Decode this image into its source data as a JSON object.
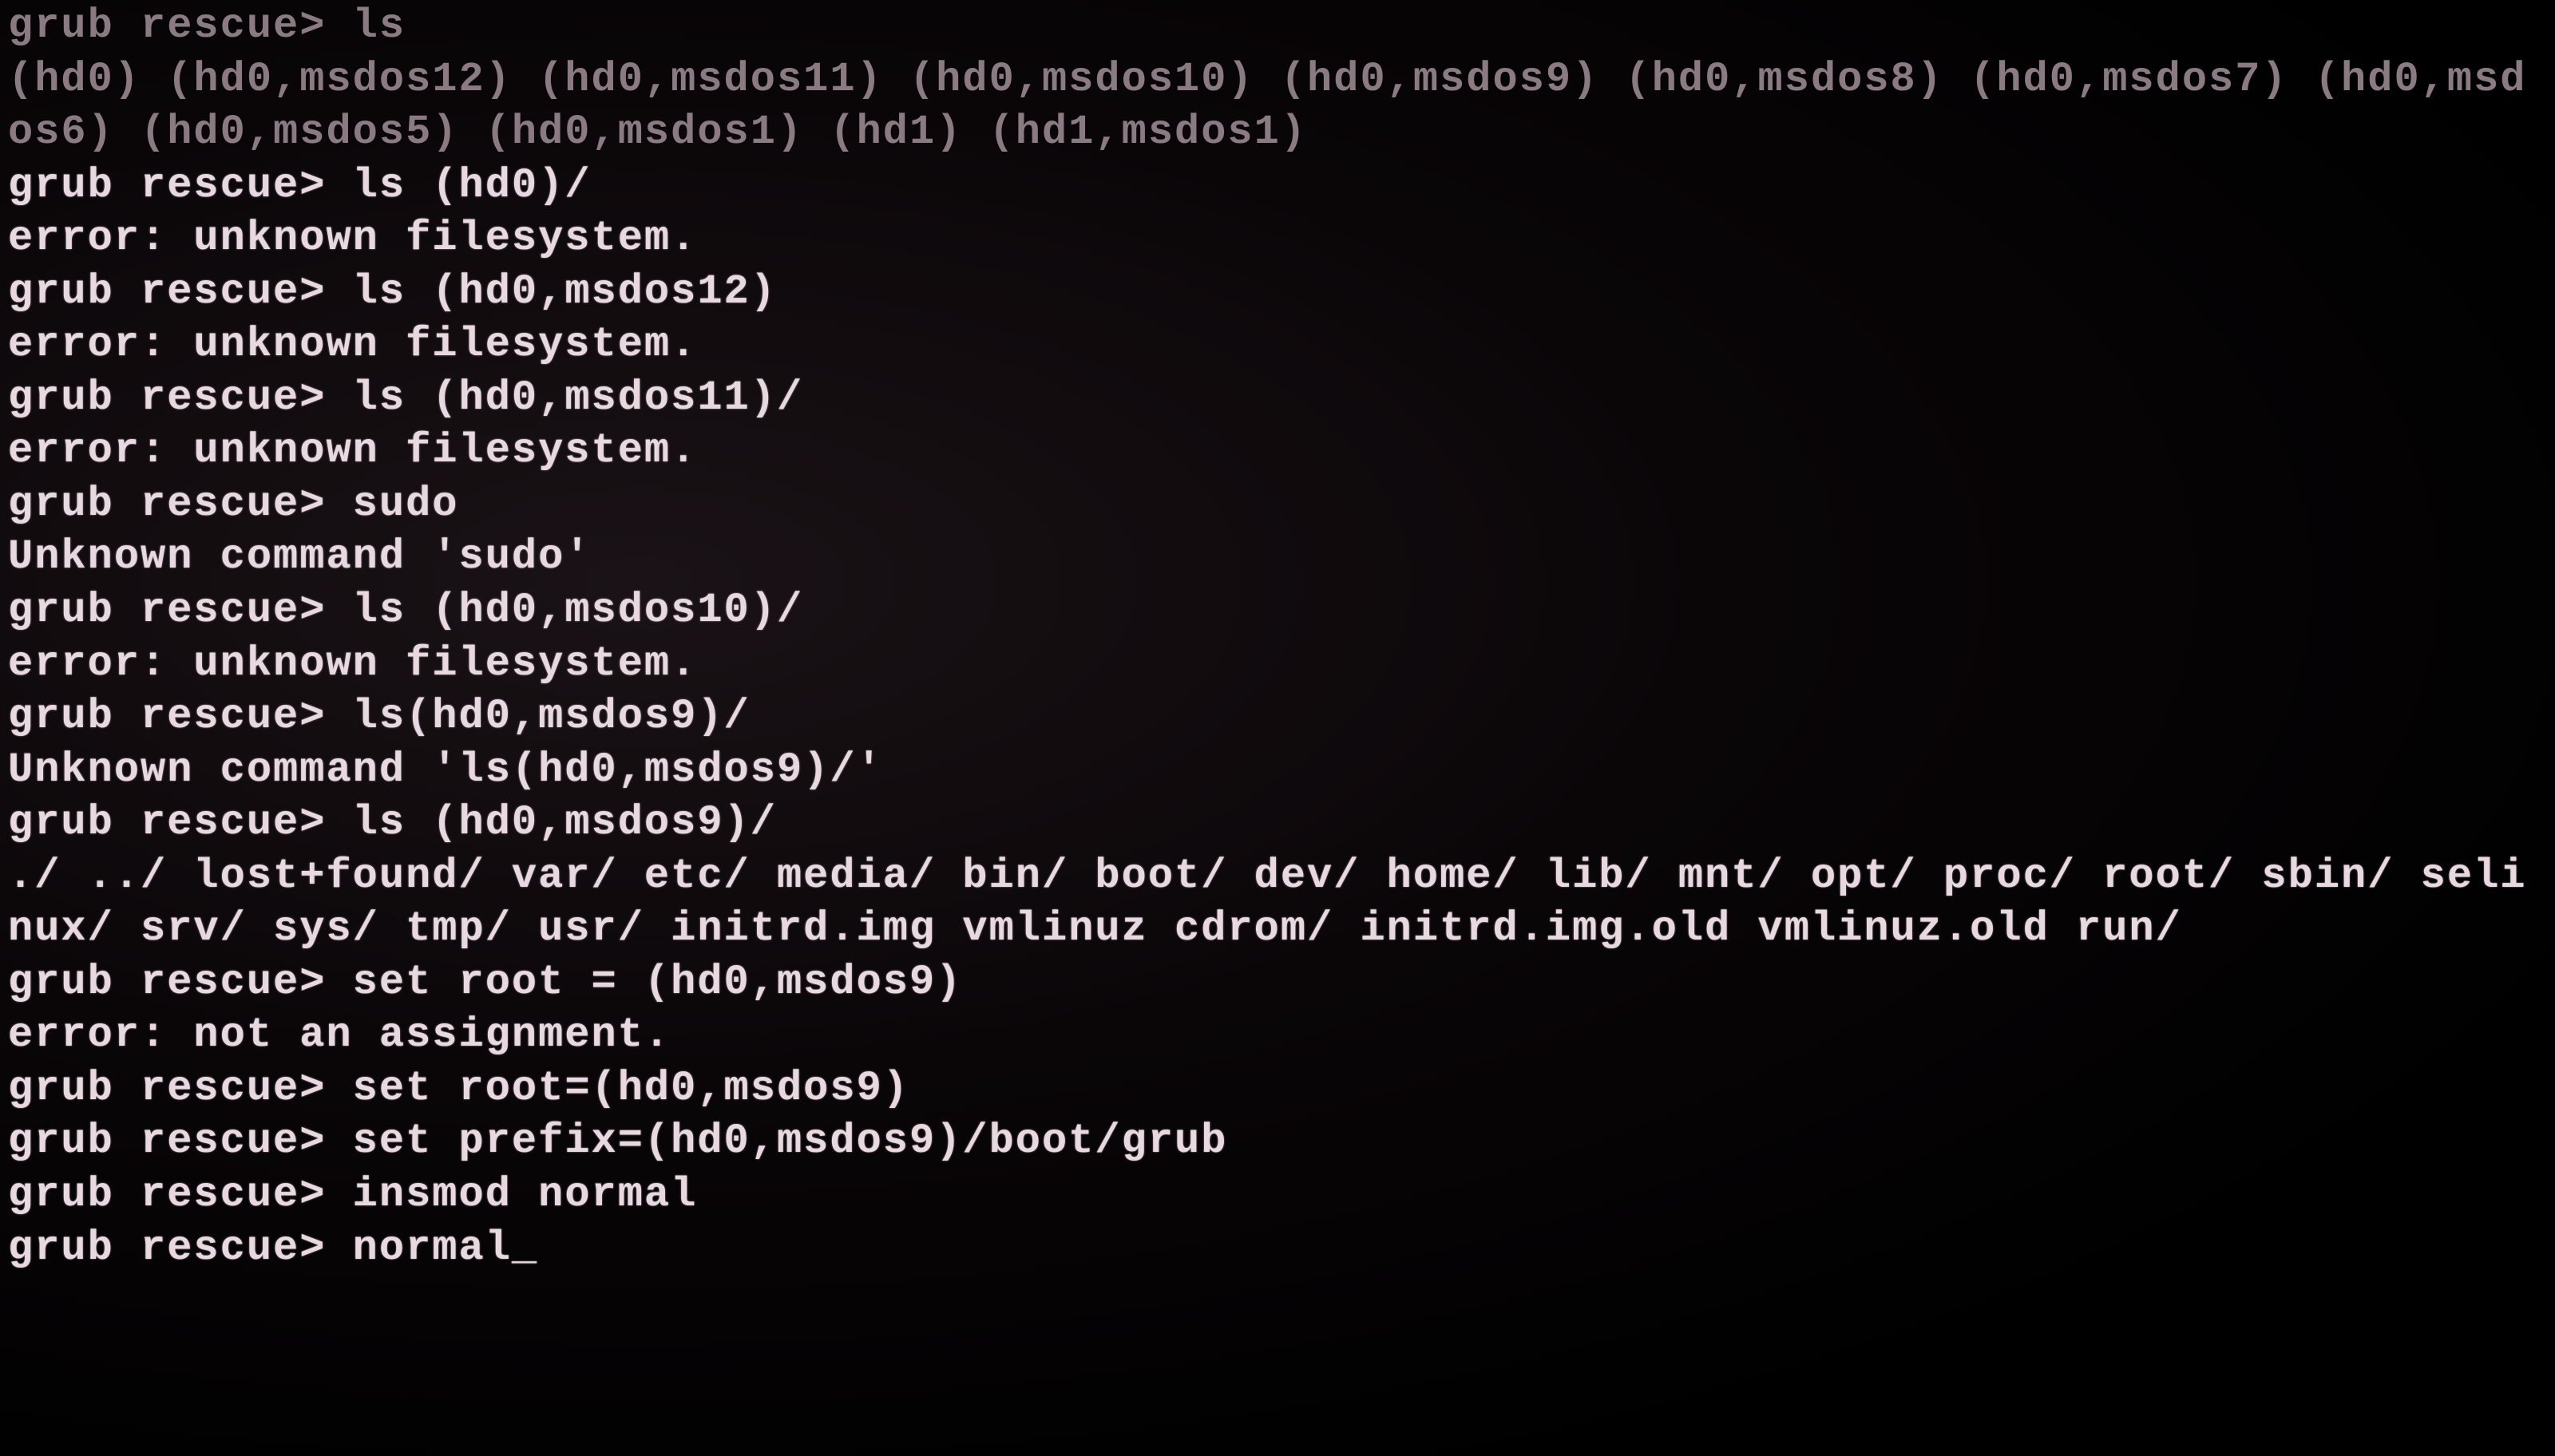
{
  "terminal": {
    "prompt": "grub rescue> ",
    "cursor": "_",
    "lines": [
      {
        "prompt": true,
        "dim": true,
        "text": "ls"
      },
      {
        "prompt": false,
        "dim": true,
        "text": "(hd0) (hd0,msdos12) (hd0,msdos11) (hd0,msdos10) (hd0,msdos9) (hd0,msdos8) (hd0,msdos7) (hd0,msdos6) (hd0,msdos5) (hd0,msdos1) (hd1) (hd1,msdos1)"
      },
      {
        "prompt": true,
        "dim": false,
        "text": "ls (hd0)/"
      },
      {
        "prompt": false,
        "dim": false,
        "text": "error: unknown filesystem."
      },
      {
        "prompt": true,
        "dim": false,
        "text": "ls (hd0,msdos12)"
      },
      {
        "prompt": false,
        "dim": false,
        "text": "error: unknown filesystem."
      },
      {
        "prompt": true,
        "dim": false,
        "text": "ls (hd0,msdos11)/"
      },
      {
        "prompt": false,
        "dim": false,
        "text": "error: unknown filesystem."
      },
      {
        "prompt": true,
        "dim": false,
        "text": "sudo"
      },
      {
        "prompt": false,
        "dim": false,
        "text": "Unknown command 'sudo'"
      },
      {
        "prompt": true,
        "dim": false,
        "text": "ls (hd0,msdos10)/"
      },
      {
        "prompt": false,
        "dim": false,
        "text": "error: unknown filesystem."
      },
      {
        "prompt": true,
        "dim": false,
        "text": "ls(hd0,msdos9)/"
      },
      {
        "prompt": false,
        "dim": false,
        "text": "Unknown command 'ls(hd0,msdos9)/'"
      },
      {
        "prompt": true,
        "dim": false,
        "text": "ls (hd0,msdos9)/"
      },
      {
        "prompt": false,
        "dim": false,
        "text": "./ ../ lost+found/ var/ etc/ media/ bin/ boot/ dev/ home/ lib/ mnt/ opt/ proc/ root/ sbin/ selinux/ srv/ sys/ tmp/ usr/ initrd.img vmlinuz cdrom/ initrd.img.old vmlinuz.old run/"
      },
      {
        "prompt": true,
        "dim": false,
        "text": "set root = (hd0,msdos9)"
      },
      {
        "prompt": false,
        "dim": false,
        "text": "error: not an assignment."
      },
      {
        "prompt": true,
        "dim": false,
        "text": "set root=(hd0,msdos9)"
      },
      {
        "prompt": true,
        "dim": false,
        "text": "set prefix=(hd0,msdos9)/boot/grub"
      },
      {
        "prompt": true,
        "dim": false,
        "text": "insmod normal"
      },
      {
        "prompt": true,
        "dim": false,
        "text": "normal",
        "cursor": true
      }
    ]
  }
}
